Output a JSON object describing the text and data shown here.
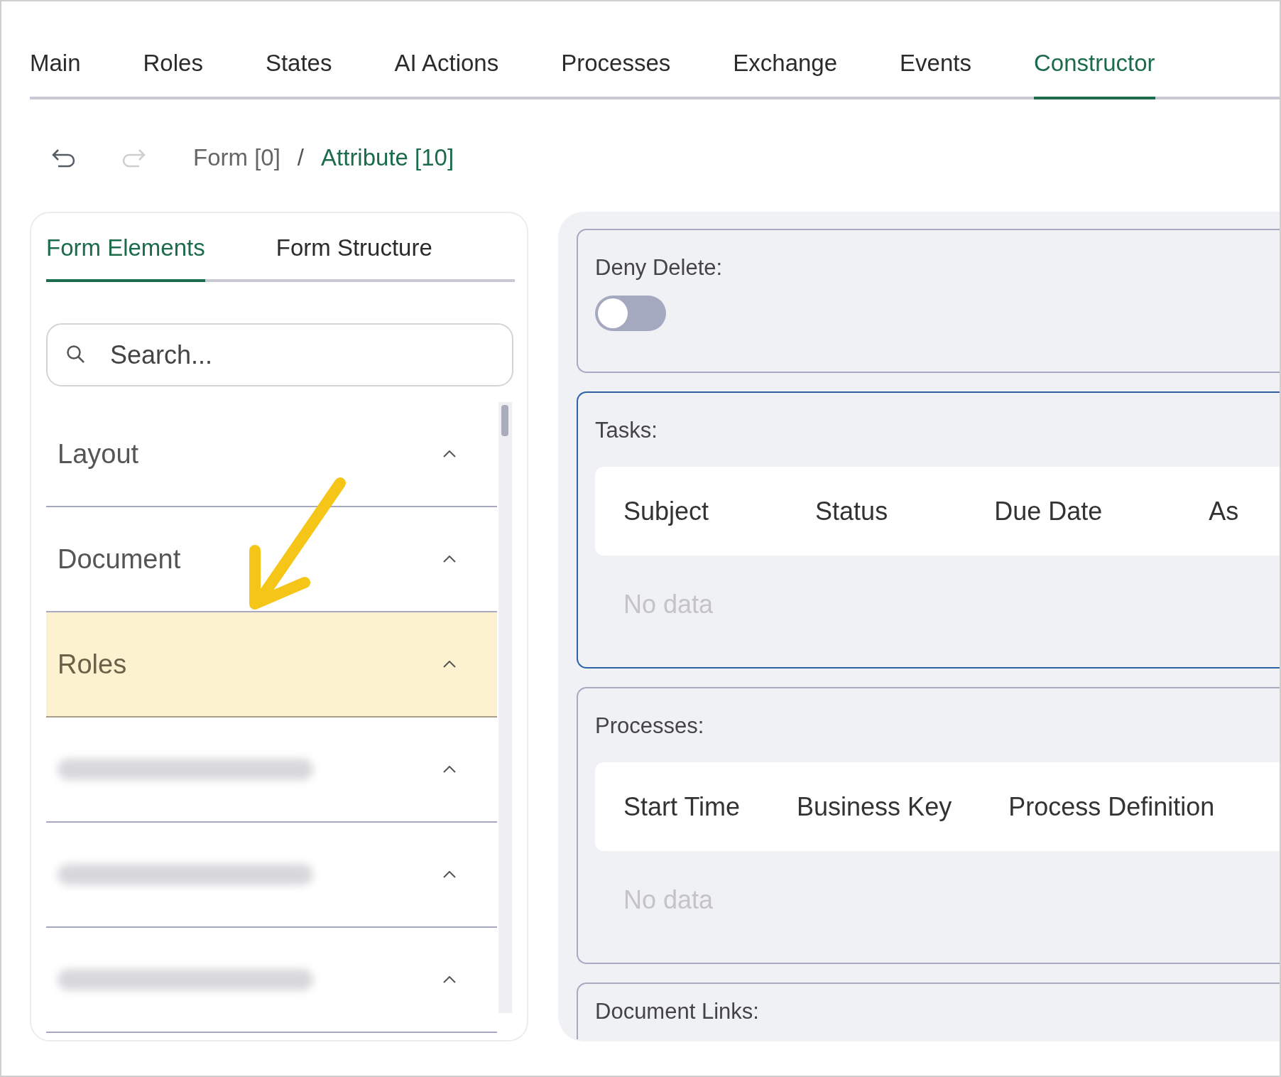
{
  "tabs": [
    {
      "label": "Main",
      "selected": false
    },
    {
      "label": "Roles",
      "selected": false
    },
    {
      "label": "States",
      "selected": false
    },
    {
      "label": "AI Actions",
      "selected": false
    },
    {
      "label": "Processes",
      "selected": false
    },
    {
      "label": "Exchange",
      "selected": false
    },
    {
      "label": "Events",
      "selected": false
    },
    {
      "label": "Constructor",
      "selected": true
    }
  ],
  "history": {
    "undo_disabled": false,
    "redo_disabled": true
  },
  "breadcrumb": {
    "separator": "/",
    "items": [
      {
        "label": "Form [0]",
        "current": false
      },
      {
        "label": "Attribute [10]",
        "current": true
      }
    ]
  },
  "sidebar": {
    "tabs": [
      {
        "label": "Form Elements",
        "selected": true
      },
      {
        "label": "Form Structure",
        "selected": false
      }
    ],
    "search": {
      "placeholder": "Search..."
    },
    "groups": [
      {
        "kind": "plain",
        "label": "Layout",
        "highlighted": false
      },
      {
        "kind": "plain",
        "label": "Document",
        "highlighted": false
      },
      {
        "kind": "plain",
        "label": "Roles",
        "highlighted": true
      },
      {
        "kind": "blurred",
        "highlighted": false
      },
      {
        "kind": "blurred",
        "highlighted": false
      },
      {
        "kind": "blurred",
        "highlighted": false
      }
    ]
  },
  "deny_delete": {
    "label": "Deny Delete:",
    "on": false
  },
  "tables": [
    {
      "label": "Tasks:",
      "focused": true,
      "columns": [
        "Subject",
        "Status",
        "Due Date",
        "As"
      ],
      "empty_text": "No data"
    },
    {
      "label": "Processes:",
      "focused": false,
      "columns": [
        "Start Time",
        "Business Key",
        "Process Definition"
      ],
      "empty_text": "No data"
    }
  ],
  "document_links": {
    "label": "Document Links:"
  }
}
